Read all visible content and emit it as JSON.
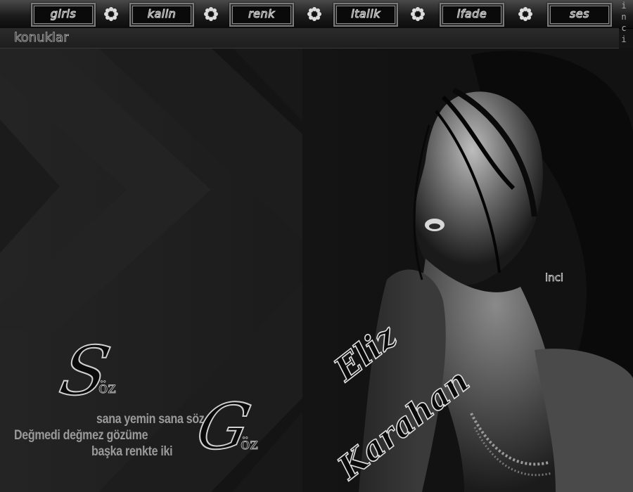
{
  "menu": {
    "items": [
      {
        "label": "giris"
      },
      {
        "label": "kalin"
      },
      {
        "label": "renk"
      },
      {
        "label": "italik"
      },
      {
        "label": "ifade"
      },
      {
        "label": "ses"
      }
    ],
    "separator_icon": "flower-icon",
    "side_letters": [
      "i",
      "n",
      "c",
      "i"
    ]
  },
  "subbar": {
    "link_label": "konuklar"
  },
  "artwork": {
    "watermark": "inci",
    "singer_first": "Eliz",
    "singer_last": "Karahan"
  },
  "poem": {
    "word1_initial": "S",
    "word1_rest": "öz",
    "word2_initial": "G",
    "word2_rest": "öz",
    "line1": "sana yemin sana söz",
    "line2": "Değmedi değmez gözüme",
    "line3": "başka renkte iki"
  },
  "colors": {
    "background": "#161616",
    "text_outline": "#d0d0d0",
    "menu_bar": "#2a2a2a"
  }
}
